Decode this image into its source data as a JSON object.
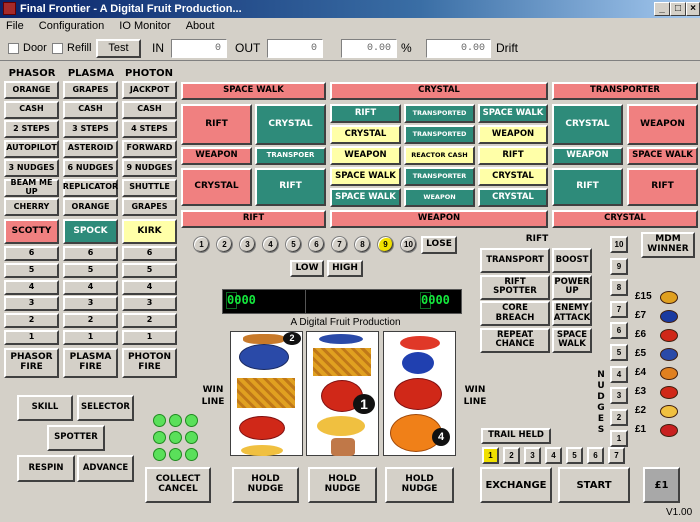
{
  "window": {
    "title": "Final Frontier - A Digital Fruit Production...",
    "controls": [
      "_",
      "□",
      "×"
    ]
  },
  "menu": [
    "File",
    "Configuration",
    "IO Monitor",
    "About"
  ],
  "toolbar": {
    "door_label": "Door",
    "refill_label": "Refill",
    "test_label": "Test",
    "in_label": "IN",
    "in_value": "0",
    "out_label": "OUT",
    "out_value": "0",
    "pct_value": "0.00",
    "pct_sign": "%",
    "drift_value": "0.00",
    "drift_label": "Drift"
  },
  "columns": {
    "headers": [
      "PHASOR",
      "PLASMA",
      "PHOTON"
    ],
    "rows": [
      [
        "ORANGE",
        "GRAPES",
        "JACKPOT"
      ],
      [
        "CASH",
        "CASH",
        "CASH"
      ],
      [
        "2 STEPS",
        "3 STEPS",
        "4 STEPS"
      ],
      [
        "AUTOPILOT",
        "ASTEROID",
        "FORWARD"
      ],
      [
        "3 NUDGES",
        "6 NUDGES",
        "9 NUDGES"
      ],
      [
        "BEAM ME UP",
        "REPLICATOR",
        "SHUTTLE"
      ],
      [
        "CHERRY",
        "ORANGE",
        "GRAPES"
      ]
    ],
    "characters": [
      "SCOTTY",
      "SPOCK",
      "KIRK"
    ],
    "steps": [
      [
        "6",
        "6",
        "6"
      ],
      [
        "5",
        "5",
        "5"
      ],
      [
        "4",
        "4",
        "4"
      ],
      [
        "3",
        "3",
        "3"
      ],
      [
        "2",
        "2",
        "2"
      ],
      [
        "1",
        "1",
        "1"
      ]
    ],
    "fire": [
      "PHASOR FIRE",
      "PLASMA FIRE",
      "PHOTON FIRE"
    ]
  },
  "feature": {
    "top": [
      "SPACE WALK",
      "CRYSTAL",
      "TRANSPORTER"
    ],
    "left": [
      "RIFT",
      "CRYSTAL",
      "WEAPON",
      "TRANSPOER",
      "CRYSTAL",
      "RIFT"
    ],
    "center": [
      [
        "RIFT",
        "TRANSPORTED",
        "SPACE WALK"
      ],
      [
        "CRYSTAL",
        "TRANSPORTED",
        "WEAPON"
      ],
      [
        "WEAPON",
        "REACTOR CASH",
        "RIFT"
      ],
      [
        "SPACE WALK",
        "TRANSPORTER",
        "CRYSTAL"
      ],
      [
        "SPACE WALK",
        "WEAPON",
        "CRYSTAL"
      ]
    ],
    "right": [
      "CRYSTAL",
      "WEAPON",
      "WEAPON",
      "SPACE WALK",
      "RIFT",
      "RIFT"
    ],
    "bottom": [
      "RIFT",
      "WEAPON",
      "CRYSTAL"
    ]
  },
  "number_trail": [
    "1",
    "2",
    "3",
    "4",
    "5",
    "6",
    "7",
    "8",
    "9",
    "10"
  ],
  "number_trail_active": "9",
  "lose_label": "LOSE",
  "low_label": "LOW",
  "high_label": "HIGH",
  "led": {
    "left": "0000",
    "right": "0000"
  },
  "reels_caption": "A Digital Fruit Production",
  "win_line_label": "WIN LINE",
  "reel_badges": [
    "2",
    "1",
    "4"
  ],
  "rift": {
    "label": "RIFT",
    "buttons": [
      [
        "TRANSPORT",
        "BOOST"
      ],
      [
        "RIFT SPOTTER",
        "POWER UP"
      ],
      [
        "CORE BREACH",
        "ENEMY ATTACK"
      ],
      [
        "REPEAT CHANCE",
        "SPACE WALK"
      ]
    ]
  },
  "nudge_ladder": [
    "10",
    "9",
    "8",
    "7",
    "6",
    "5",
    "4",
    "3",
    "2",
    "1"
  ],
  "nudges_label": "NUDGES",
  "mdm_winner": "MDM WINNER",
  "prizes": [
    "£15",
    "£7",
    "£6",
    "£5",
    "£4",
    "£3",
    "£2",
    "£1"
  ],
  "trail_held_label": "TRAIL HELD",
  "trail_held": [
    "1",
    "2",
    "3",
    "4",
    "5",
    "6",
    "7"
  ],
  "trail_held_active": "1",
  "left_buttons": {
    "skill": "SKILL",
    "selector": "SELECTOR",
    "spotter": "SPOTTER",
    "respin": "RESPIN",
    "advance": "ADVANCE"
  },
  "bottom_buttons": {
    "collect": "COLLECT CANCEL",
    "hold1": "HOLD NUDGE",
    "hold2": "HOLD NUDGE",
    "hold3": "HOLD NUDGE",
    "exchange": "EXCHANGE",
    "start": "START",
    "stake": "£1"
  },
  "version": "V1.00",
  "colors": {
    "pink": "#f08080",
    "teal": "#2e8b7a",
    "yellow": "#ffffa8",
    "lamp_on": "#f0e000",
    "led_green": "#14e83c"
  }
}
